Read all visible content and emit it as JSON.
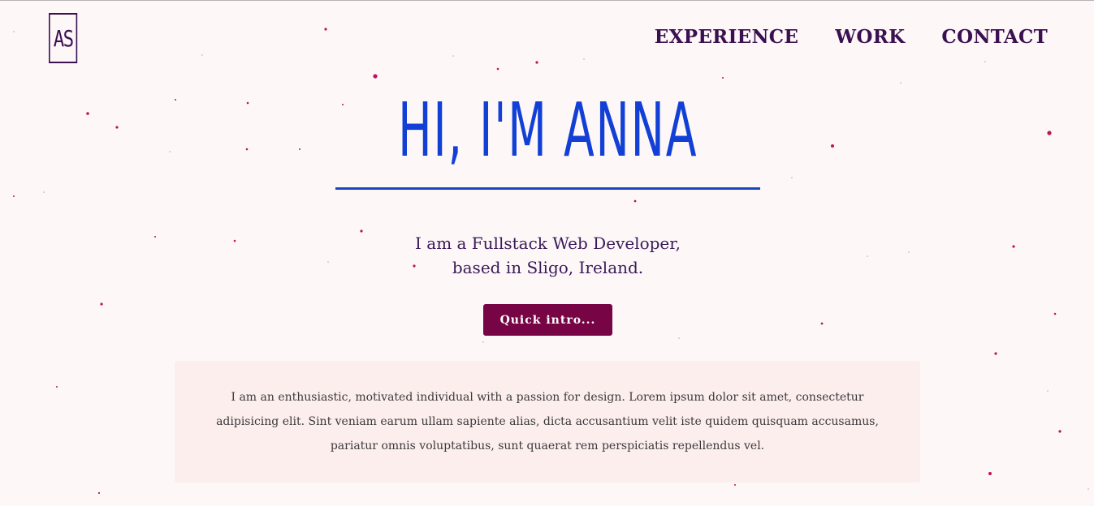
{
  "header": {
    "logo_text": "AS",
    "nav": [
      {
        "label": "EXPERIENCE"
      },
      {
        "label": "WORK"
      },
      {
        "label": "CONTACT"
      }
    ]
  },
  "hero": {
    "title": "HI, I'M ANNA",
    "tagline_line1": "I am a Fullstack Web Developer,",
    "tagline_line2": "based in Sligo, Ireland.",
    "button_label": "Quick intro..."
  },
  "about": {
    "text": "I am an enthusiastic, motivated individual with a passion for design. Lorem ipsum dolor sit amet, consectetur adipisicing elit. Sint veniam earum ullam sapiente alias, dicta accusantium velit iste quidem quisquam accusamus, pariatur omnis voluptatibus, sunt quaerat rem perspiciatis repellendus vel."
  },
  "colors": {
    "background": "#fdf7f8",
    "title": "#1240d6",
    "nav": "#3a1050",
    "button": "#770444",
    "panel": "#fdeeee",
    "dots": "#c0125a"
  }
}
